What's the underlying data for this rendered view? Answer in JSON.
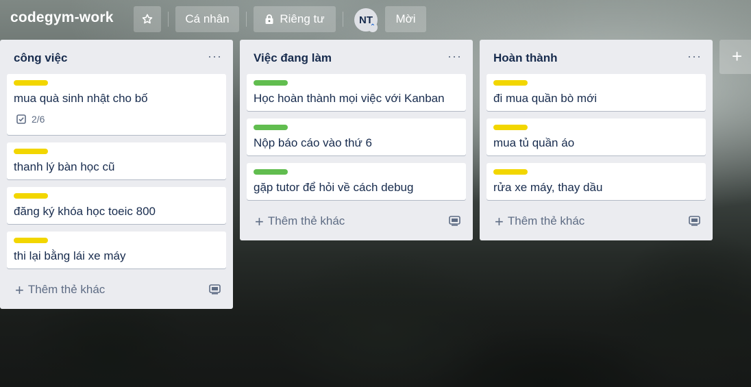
{
  "board": {
    "title": "codegym-work",
    "personal_label": "Cá nhân",
    "private_label": "Riêng tư",
    "avatar_initials": "NT",
    "invite_label": "Mời"
  },
  "colors": {
    "yellow_label": "#f2d600",
    "green_label": "#61bd4f"
  },
  "lists": [
    {
      "title": "công việc",
      "menu": "···",
      "add_label": "Thêm thẻ khác",
      "cards": [
        {
          "label_color": "yellow",
          "text": "mua quà sinh nhật cho bố",
          "checklist": "2/6"
        },
        {
          "label_color": "yellow",
          "text": "thanh lý bàn học cũ"
        },
        {
          "label_color": "yellow",
          "text": "đăng ký khóa học toeic 800"
        },
        {
          "label_color": "yellow",
          "text": "thi lại bằng lái xe máy"
        }
      ]
    },
    {
      "title": "Việc đang làm",
      "menu": "···",
      "add_label": "Thêm thẻ khác",
      "cards": [
        {
          "label_color": "green",
          "text": "Học hoàn thành mọi việc với Kanban"
        },
        {
          "label_color": "green",
          "text": "Nộp báo cáo vào thứ 6"
        },
        {
          "label_color": "green",
          "text": "gặp tutor để hỏi về cách debug"
        }
      ]
    },
    {
      "title": "Hoàn thành",
      "menu": "···",
      "add_label": "Thêm thẻ khác",
      "cards": [
        {
          "label_color": "yellow",
          "text": "đi mua quần bò mới"
        },
        {
          "label_color": "yellow",
          "text": "mua tủ quần áo"
        },
        {
          "label_color": "yellow",
          "text": "rửa xe máy, thay dầu"
        }
      ]
    }
  ],
  "add_list": {
    "icon": "+"
  }
}
